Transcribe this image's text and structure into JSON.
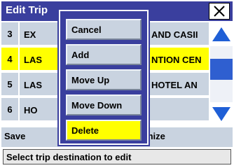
{
  "window": {
    "title": "Edit Trip"
  },
  "rows": [
    {
      "num": "3",
      "name": "EXCALIBUR HOTEL AND CASINO",
      "highlighted": false
    },
    {
      "num": "4",
      "name": "LAS VEGAS CONVENTION CENTER",
      "highlighted": true
    },
    {
      "num": "5",
      "name": "LAS VEGAS HILTON HOTEL AND CASINO",
      "highlighted": false
    },
    {
      "num": "6",
      "name": "HOOVER DAM",
      "highlighted": false
    }
  ],
  "visible_fragments": {
    "row3_left": "EX",
    "row3_right": "AND CASII",
    "row4_left": "LAS",
    "row4_right": "NTION CEN",
    "row5_left": "LAS",
    "row5_right": "HOTEL AN",
    "row6_left": "HO"
  },
  "bottom": {
    "save_label": "Save",
    "optimize_label": "mize"
  },
  "status": {
    "text": "Select trip destination to edit"
  },
  "popup_menu": {
    "items": [
      {
        "label": "Cancel",
        "selected": false
      },
      {
        "label": "Add",
        "selected": false
      },
      {
        "label": "Move Up",
        "selected": false
      },
      {
        "label": "Move Down",
        "selected": false
      },
      {
        "label": "Delete",
        "selected": true
      }
    ]
  },
  "colors": {
    "title_bar": "#3a3f9e",
    "row_bg": "#c9d3e0",
    "highlight": "#ffff00",
    "scroll_arrow": "#1f5fd6",
    "scroll_thumb": "#2f5fd0"
  },
  "icons": {
    "close": "close-icon",
    "scroll_up": "scroll-up-arrow-icon",
    "scroll_down": "scroll-down-arrow-icon"
  }
}
